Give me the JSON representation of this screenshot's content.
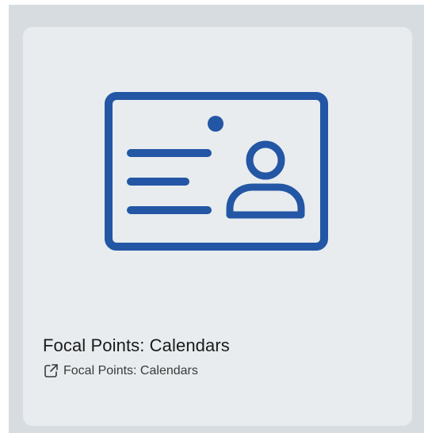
{
  "card": {
    "title": "Focal Points: Calendars",
    "link_label": "Focal Points: Calendars",
    "illustration_icon": "id-card-icon",
    "link_icon": "external-link-icon"
  },
  "colors": {
    "accent": "#2356a4",
    "card_background": "#e8ecef",
    "outer_background": "#d6dce0",
    "title_text": "#1a1a1a"
  }
}
